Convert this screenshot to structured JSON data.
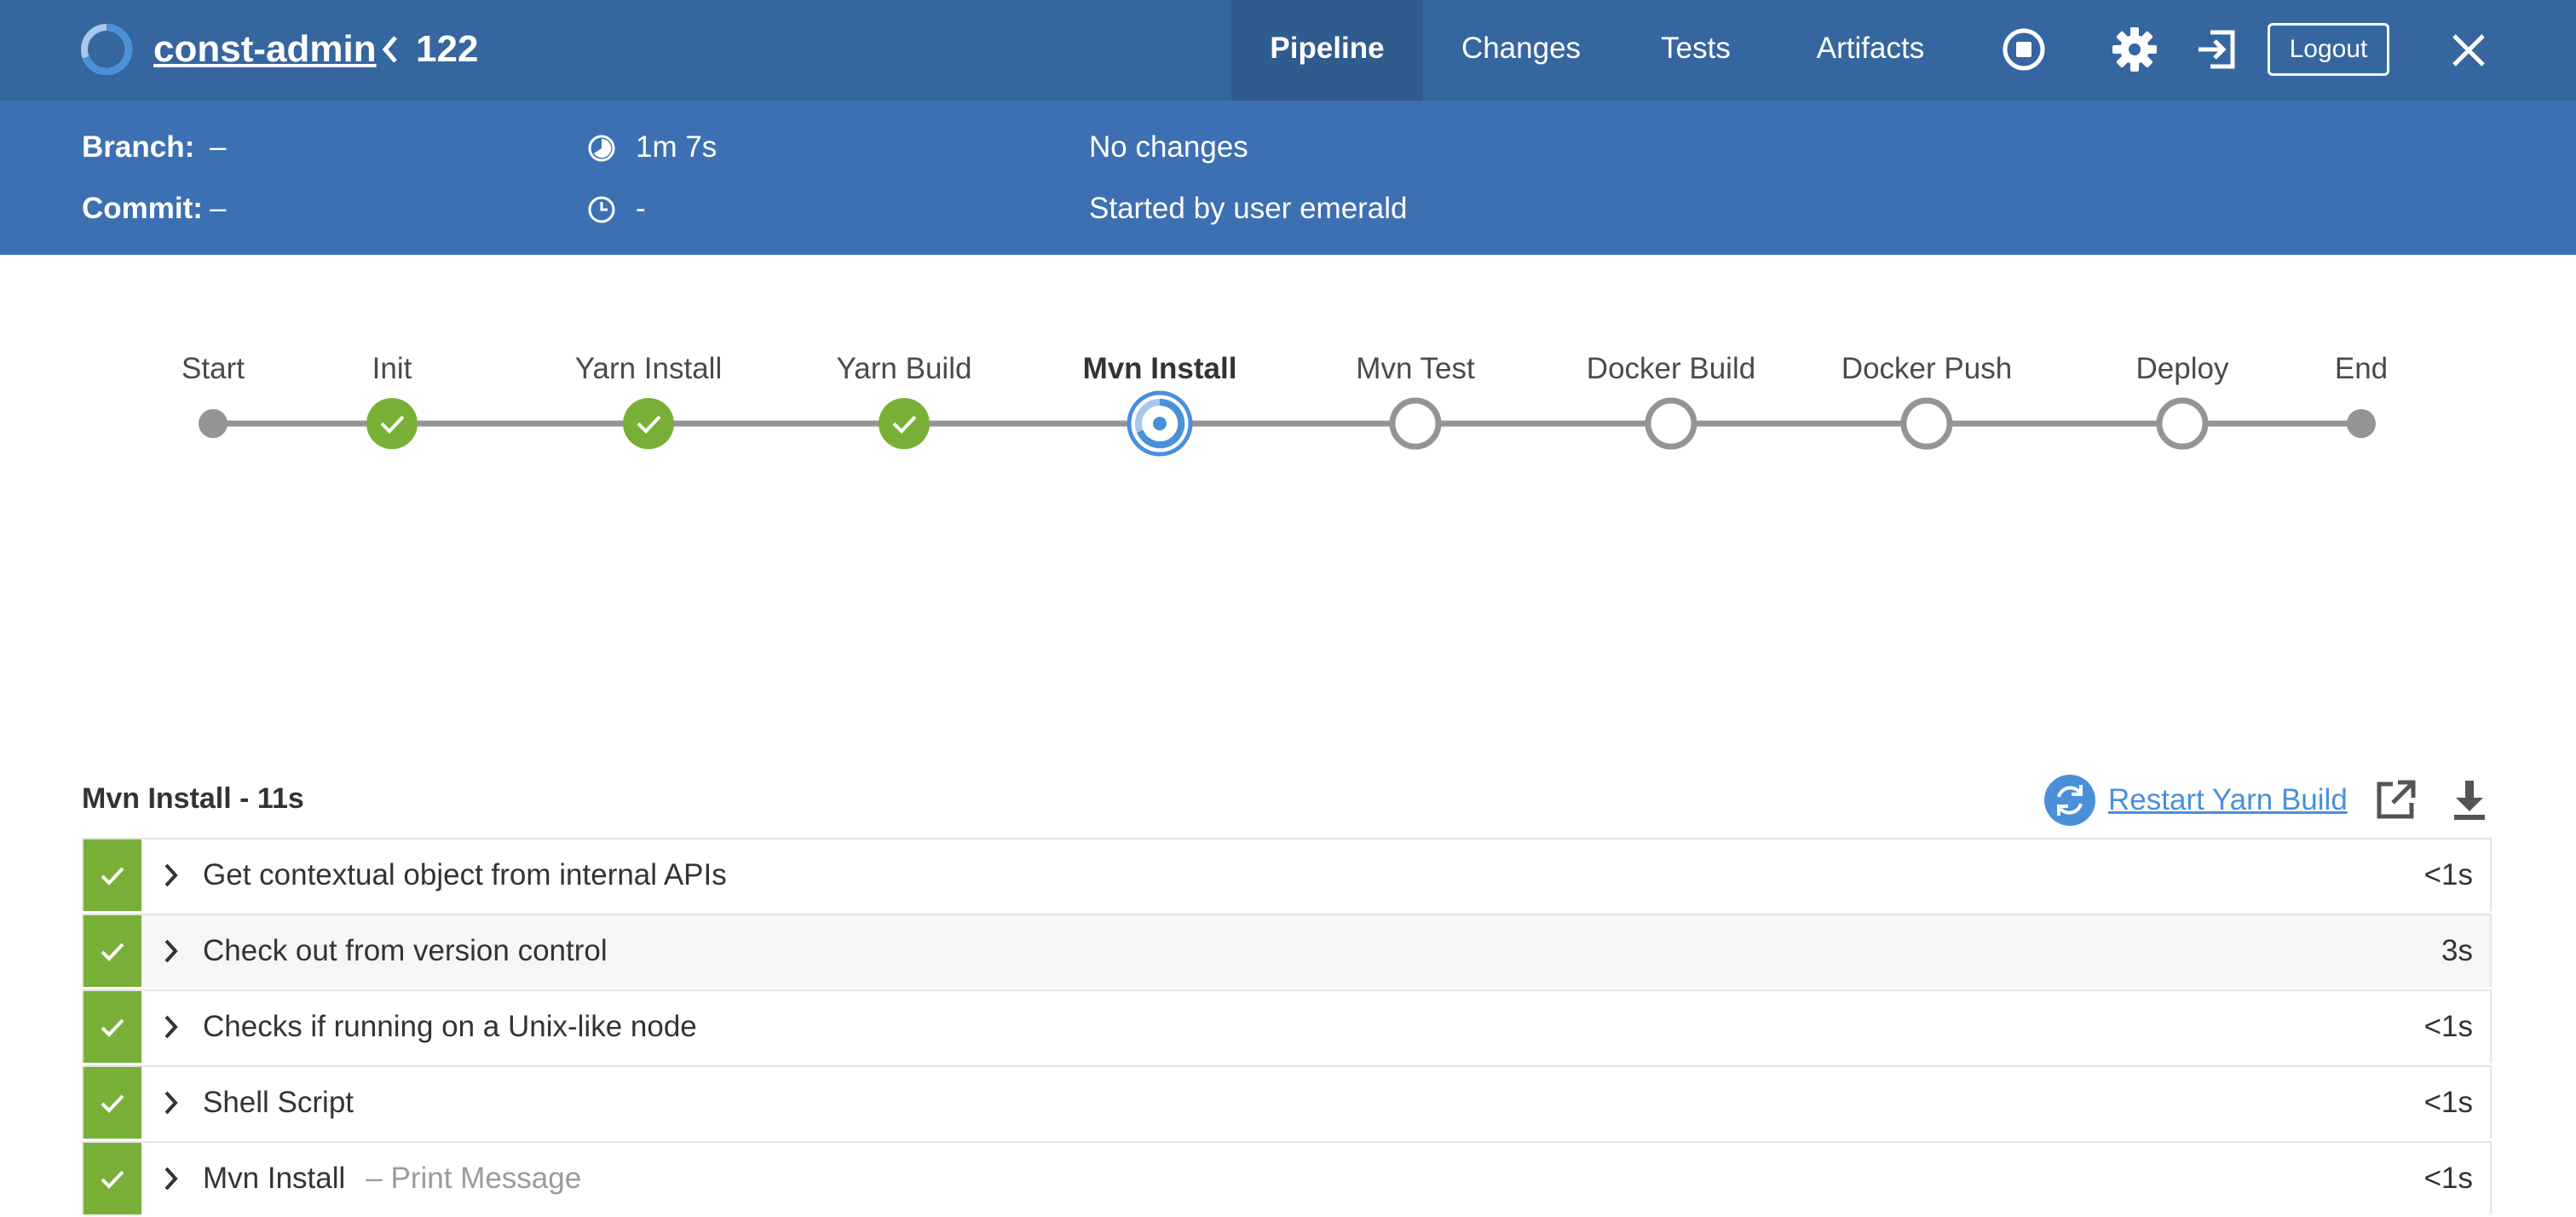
{
  "header": {
    "project": "const-admin",
    "run_number": "122",
    "tabs": [
      {
        "label": "Pipeline",
        "active": true
      },
      {
        "label": "Changes",
        "active": false
      },
      {
        "label": "Tests",
        "active": false
      },
      {
        "label": "Artifacts",
        "active": false
      }
    ],
    "icons": [
      "stop-icon",
      "gear-icon",
      "exit-icon",
      "close-icon"
    ],
    "logout_label": "Logout"
  },
  "meta": {
    "branch_label": "Branch:",
    "branch_value": "–",
    "commit_label": "Commit:",
    "commit_value": "–",
    "duration": "1m 7s",
    "started": "-",
    "changes": "No changes",
    "started_by": "Started by user emerald"
  },
  "pipeline": {
    "stages": [
      {
        "name": "Start",
        "status": "terminal"
      },
      {
        "name": "Init",
        "status": "success"
      },
      {
        "name": "Yarn Install",
        "status": "success"
      },
      {
        "name": "Yarn Build",
        "status": "success"
      },
      {
        "name": "Mvn Install",
        "status": "running"
      },
      {
        "name": "Mvn Test",
        "status": "not-built"
      },
      {
        "name": "Docker Build",
        "status": "not-built"
      },
      {
        "name": "Docker Push",
        "status": "not-built"
      },
      {
        "name": "Deploy",
        "status": "not-built"
      },
      {
        "name": "End",
        "status": "terminal"
      }
    ]
  },
  "steps_panel": {
    "title": "Mvn Install - 11s",
    "restart_label": "Restart Yarn Build",
    "steps": [
      {
        "name": "Get contextual object from internal APIs",
        "sub": "",
        "duration": "<1s",
        "status": "success"
      },
      {
        "name": "Check out from version control",
        "sub": "",
        "duration": "3s",
        "status": "success"
      },
      {
        "name": "Checks if running on a Unix-like node",
        "sub": "",
        "duration": "<1s",
        "status": "success"
      },
      {
        "name": "Shell Script",
        "sub": "",
        "duration": "<1s",
        "status": "success"
      },
      {
        "name": "Mvn Install",
        "sub": "– Print Message",
        "duration": "<1s",
        "status": "success"
      }
    ]
  },
  "colors": {
    "topbar": "#36669f",
    "metabar": "#3d70b2",
    "success": "#78b037",
    "running": "#4a90d9",
    "line": "#949494"
  }
}
